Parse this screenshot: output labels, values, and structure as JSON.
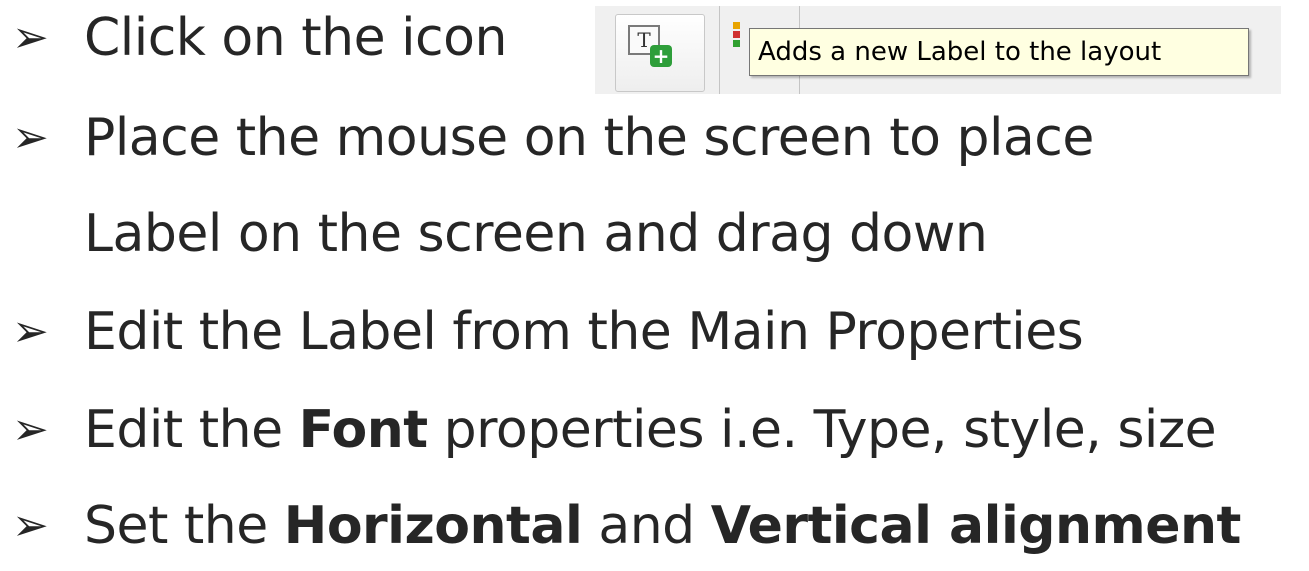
{
  "bullet_glyph": "➢",
  "lines": {
    "l1": "Click on the icon",
    "l2": "Place the mouse on the screen to place",
    "l3": "Label on the screen and drag down",
    "l4": "Edit the Label from the Main Properties",
    "l5a": "Edit the ",
    "l5b": "Font",
    "l5c": " properties i.e. Type, style, size",
    "l6a": "Set the ",
    "l6b": "Horizontal",
    "l6c": " and ",
    "l6d": "Vertical alignment"
  },
  "toolbar": {
    "icon_glyph": "T",
    "plus_glyph": "+",
    "tooltip": "Adds a new Label to the layout"
  }
}
